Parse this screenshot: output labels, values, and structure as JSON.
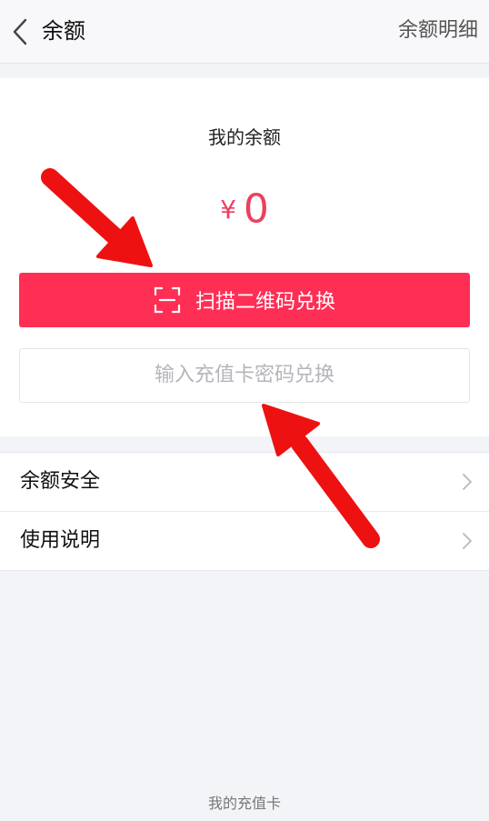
{
  "nav": {
    "back_icon": "chevron-left-icon",
    "title": "余额",
    "right_link": "余额明细"
  },
  "balance": {
    "label": "我的余额",
    "currency": "¥",
    "amount": "0"
  },
  "actions": {
    "scan_icon": "scan-frame-icon",
    "scan_label": "扫描二维码兑换",
    "code_placeholder": "输入充值卡密码兑换"
  },
  "menu": {
    "items": [
      {
        "label": "余额安全",
        "icon": "chevron-right-icon"
      },
      {
        "label": "使用说明",
        "icon": "chevron-right-icon"
      }
    ]
  },
  "footer": {
    "link": "我的充值卡"
  },
  "colors": {
    "accent": "#ff2e55",
    "amount": "#ec3f5e",
    "annotation_arrow": "#ee1111"
  }
}
